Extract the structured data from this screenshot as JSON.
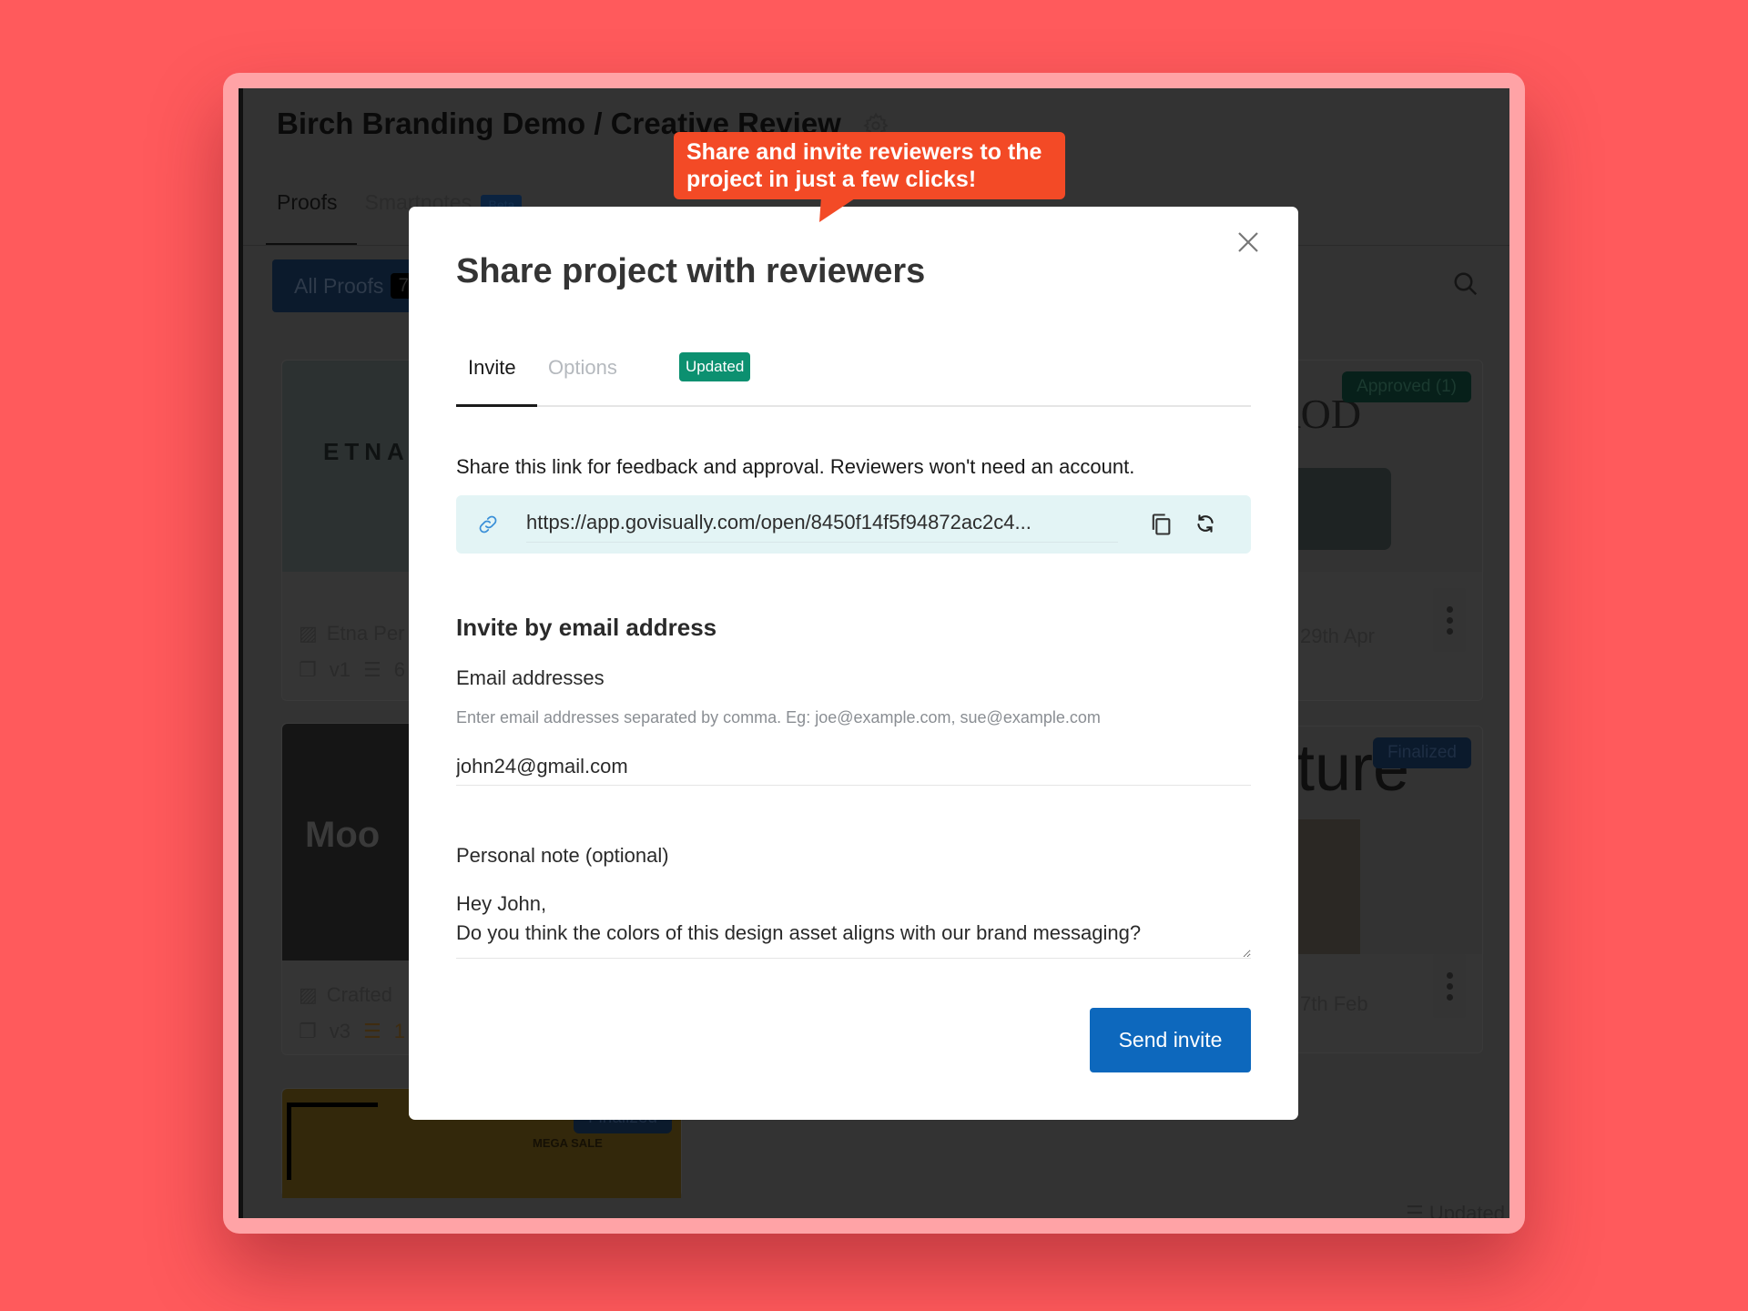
{
  "background_app": {
    "title": "Birch Branding Demo / Creative Review",
    "tabs": [
      {
        "label": "Proofs",
        "active": true
      },
      {
        "label": "Smartnotes",
        "badge": "Beta",
        "active": false
      }
    ],
    "filter_button": {
      "label": "All Proofs",
      "count": "7"
    },
    "cards": [
      {
        "thumb_text": "ETNA",
        "title": "Etna Per",
        "version": "v1",
        "comments": "6"
      },
      {
        "thumb_text": "Moo",
        "title": "Crafted",
        "version": "v3",
        "comments": "1"
      },
      {
        "thumb_text": "MEGA SALE",
        "status": "Finalized"
      },
      {
        "thumb_text": "ROD",
        "status": "Approved (1)",
        "date": "29th Apr"
      },
      {
        "thumb_text": "iture",
        "status": "Finalized",
        "date": "7th Feb"
      }
    ],
    "sort_label": "Updated"
  },
  "tooltip": {
    "text": "Share and invite reviewers to the project in just a few clicks!"
  },
  "modal": {
    "title": "Share project with reviewers",
    "tabs": [
      {
        "label": "Invite",
        "active": true
      },
      {
        "label": "Options",
        "active": false,
        "badge": "Updated"
      }
    ],
    "share_text": "Share this link for feedback and approval. Reviewers won't need an account.",
    "share_link": "https://app.govisually.com/open/8450f14f5f94872ac2c4...",
    "invite_section_title": "Invite by email address",
    "email_label": "Email addresses",
    "email_hint": "Enter email addresses separated by comma. Eg: joe@example.com, sue@example.com",
    "email_value": "john24@gmail.com",
    "note_label": "Personal note (optional)",
    "note_value": "Hey John,\nDo you think the colors of this design asset aligns with our brand messaging?",
    "send_button": "Send invite"
  },
  "colors": {
    "page_bg": "#ff5a5c",
    "tooltip": "#f34a26",
    "primary": "#0d68bd",
    "updated_badge": "#0c9070",
    "link_box": "#e3f4f5"
  }
}
